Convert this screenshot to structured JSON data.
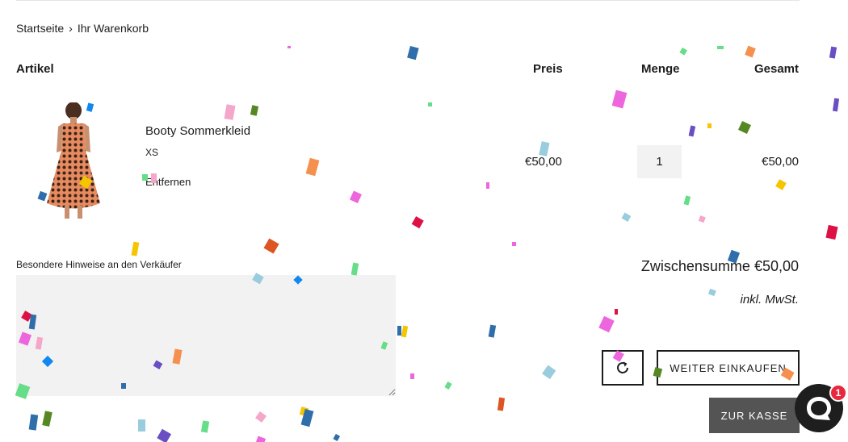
{
  "breadcrumb": {
    "home": "Startseite",
    "separator": "›",
    "current": "Ihr Warenkorb"
  },
  "table_headers": {
    "item": "Artikel",
    "price": "Preis",
    "quantity": "Menge",
    "total": "Gesamt"
  },
  "cart_item": {
    "image_icon": "dress-product-image",
    "title": "Booty Sommerkleid",
    "variant": "XS",
    "remove_label": "Entfernen",
    "price": "€50,00",
    "quantity": "1",
    "line_total": "€50,00"
  },
  "note": {
    "label": "Besondere Hinweise an den Verkäufer",
    "value": ""
  },
  "summary": {
    "subtotal": "Zwischensumme €50,00",
    "tax_note": "inkl. MwSt."
  },
  "actions": {
    "refresh_icon": "refresh-icon",
    "continue_label": "WEITER EINKAUFEN",
    "checkout_label": "ZUR KASSE"
  },
  "chat": {
    "icon": "chat-bubble-icon",
    "badge_count": "1"
  },
  "colors": {
    "text": "#1c1c1c",
    "input_bg": "#f2f2f2",
    "checkout_bg": "#545454",
    "badge": "#e8283c",
    "chat_bg": "#1e1e1e"
  }
}
